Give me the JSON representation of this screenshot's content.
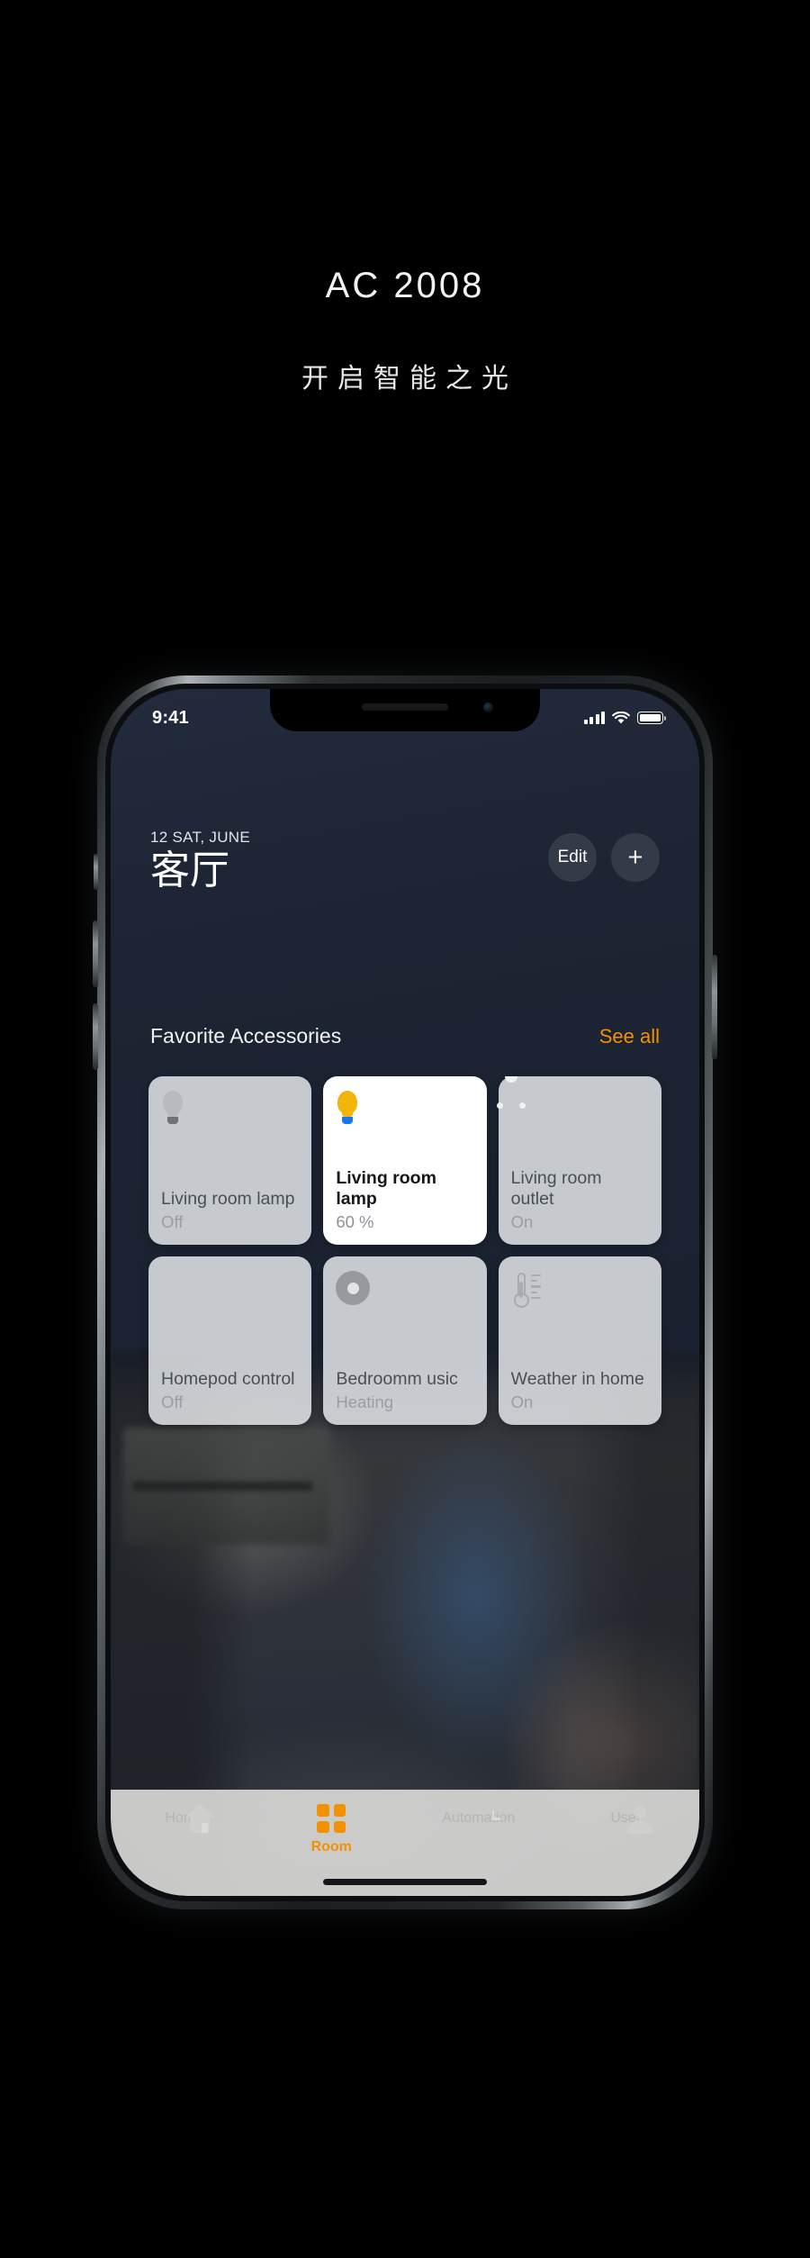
{
  "poster": {
    "title": "AC  2008",
    "subtitle": "开启智能之光"
  },
  "colors": {
    "accent": "#f39200",
    "active_card_bg": "#ffffff",
    "card_bg": "#dee0e4",
    "screen_bg": "#1b2231",
    "bulb_on": "#f2b50a",
    "bulb_base": "#1877f2"
  },
  "statusbar": {
    "time": "9:41",
    "signal_icon": "cellular-signal-icon",
    "wifi_icon": "wifi-icon",
    "battery_icon": "battery-icon"
  },
  "header": {
    "date": "12 SAT, JUNE",
    "room": "客厅",
    "edit_label": "Edit",
    "add_label": "+"
  },
  "section": {
    "title": "Favorite Accessories",
    "see_all": "See all"
  },
  "accessories": [
    {
      "name": "Living room lamp",
      "state": "Off",
      "icon": "lightbulb-icon",
      "active": false
    },
    {
      "name": "Living room lamp",
      "state": "60 %",
      "icon": "lightbulb-icon",
      "active": true
    },
    {
      "name": "Living room outlet",
      "state": "On",
      "icon": "power-outlet-icon",
      "active": false
    },
    {
      "name": "Homepod control",
      "state": "Off",
      "icon": "speaker-icon",
      "active": false
    },
    {
      "name": "Bedroomm usic",
      "state": "Heating",
      "icon": "dial-knob-icon",
      "active": false
    },
    {
      "name": "Weather in home",
      "state": "On",
      "icon": "thermometer-icon",
      "active": false
    }
  ],
  "tabbar": [
    {
      "label": "Home",
      "icon": "home-icon",
      "active": false
    },
    {
      "label": "Room",
      "icon": "grid-icon",
      "active": true
    },
    {
      "label": "Automation",
      "icon": "clock-icon",
      "active": false
    },
    {
      "label": "User",
      "icon": "user-icon",
      "active": false
    }
  ]
}
